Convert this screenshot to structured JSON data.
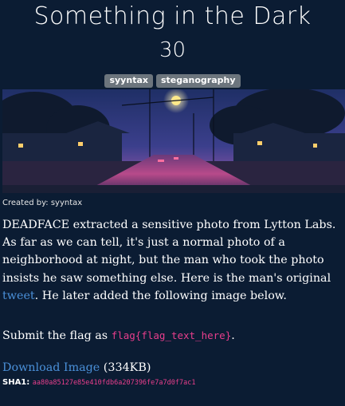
{
  "challenge": {
    "title": "Something in the Dark",
    "points": "30",
    "tags": [
      "syyntax",
      "steganography"
    ],
    "image_alt": "neighborhood-at-night-illustration",
    "created_by_label": "Created by: syyntax",
    "description": {
      "part1": "DEADFACE extracted a sensitive photo from Lytton Labs. As far as we can tell, it's just a normal photo of a neighborhood at night, but the man who took the photo insists he saw something else. Here is the man's original ",
      "link_text": "tweet",
      "part2": ". He later added the following image below."
    },
    "submit": {
      "prefix": "Submit the flag as ",
      "flag_format": "flag{flag_text_here}",
      "suffix": "."
    },
    "download": {
      "link_text": "Download Image",
      "size": " (334KB)"
    },
    "sha1": {
      "label": "SHA1:",
      "value": "aa80a85127e85e410fdb6a207396fe7a7d0f7ac1"
    }
  },
  "colors": {
    "background": "#0b1c33",
    "tag_background": "#6c757d",
    "link": "#4a90d9",
    "code": "#e83e8c"
  }
}
